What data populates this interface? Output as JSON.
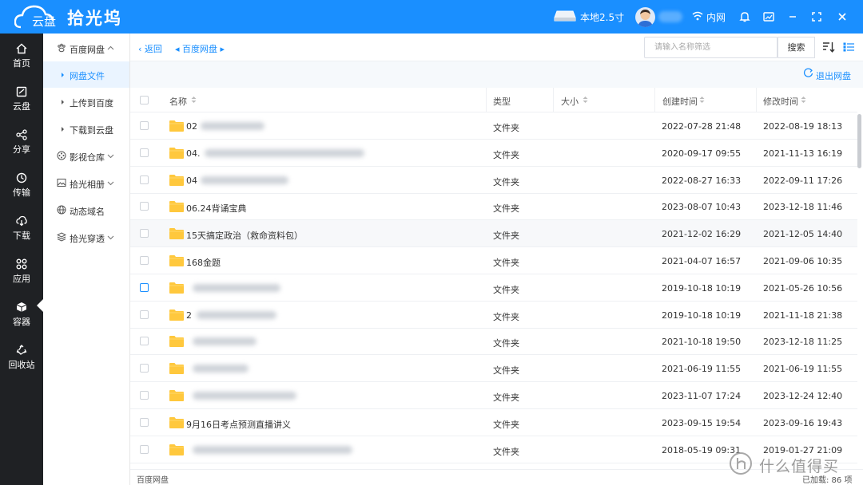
{
  "app": {
    "logo_sub": "云盘",
    "logo_name": "拾光坞",
    "disk_label": "本地2.5寸",
    "network_label": "内网"
  },
  "leftnav": [
    {
      "label": "首页",
      "icon": "home-icon"
    },
    {
      "label": "云盘",
      "icon": "cloud-disk-icon"
    },
    {
      "label": "分享",
      "icon": "share-icon"
    },
    {
      "label": "传输",
      "icon": "transfer-icon"
    },
    {
      "label": "下载",
      "icon": "download-icon"
    },
    {
      "label": "应用",
      "icon": "apps-icon"
    },
    {
      "label": "容器",
      "icon": "container-icon"
    },
    {
      "label": "回收站",
      "icon": "recycle-bin-icon"
    }
  ],
  "subnav": {
    "baidu": "百度网盘",
    "netdisk_files": "网盘文件",
    "upload_baidu": "上传到百度",
    "download_cloud": "下载到云盘",
    "video": "影视仓库",
    "album": "拾光相册",
    "ddns": "动态域名",
    "tunnel": "拾光穿透"
  },
  "toolbar": {
    "back": "返回",
    "crumb": "百度网盘",
    "search_placeholder": "请输入名称筛选",
    "search_btn": "搜索",
    "exit": "退出网盘"
  },
  "table": {
    "headers": {
      "name": "名称",
      "type": "类型",
      "size": "大小",
      "created": "创建时间",
      "modified": "修改时间"
    },
    "rows": [
      {
        "name": "02",
        "type": "文件夹",
        "created": "2022-07-28 21:48",
        "modified": "2022-08-19 18:13"
      },
      {
        "name": "04.",
        "type": "文件夹",
        "created": "2020-09-17 09:55",
        "modified": "2021-11-13 16:19"
      },
      {
        "name": "04",
        "type": "文件夹",
        "created": "2022-08-27 16:33",
        "modified": "2022-09-11 17:26"
      },
      {
        "name": "06.24背诵宝典",
        "type": "文件夹",
        "created": "2023-08-07 10:43",
        "modified": "2023-12-18 11:46"
      },
      {
        "name": "15天搞定政治（救命资料包）",
        "type": "文件夹",
        "created": "2021-12-02 16:29",
        "modified": "2021-12-05 14:40"
      },
      {
        "name": "168金题",
        "type": "文件夹",
        "created": "2021-04-07 16:57",
        "modified": "2021-09-06 10:35"
      },
      {
        "name": "",
        "type": "文件夹",
        "created": "2019-10-18 10:19",
        "modified": "2021-05-26 10:56"
      },
      {
        "name": "2",
        "type": "文件夹",
        "created": "2019-10-18 10:19",
        "modified": "2021-11-18 21:38"
      },
      {
        "name": "",
        "type": "文件夹",
        "created": "2021-10-18 19:50",
        "modified": "2023-12-18 11:25"
      },
      {
        "name": "",
        "type": "文件夹",
        "created": "2021-06-19 11:55",
        "modified": "2021-06-19 11:55"
      },
      {
        "name": "",
        "type": "文件夹",
        "created": "2023-11-07 17:24",
        "modified": "2023-12-24 12:40"
      },
      {
        "name": "9月16日考点预测直播讲义",
        "type": "文件夹",
        "created": "2023-09-15 19:54",
        "modified": "2023-09-16 19:43"
      },
      {
        "name": "",
        "type": "文件夹",
        "created": "2018-05-19 09:31",
        "modified": "2019-01-27 21:09"
      }
    ]
  },
  "footer": {
    "path": "百度网盘",
    "loaded": "已加载: 86 项"
  },
  "watermark": "什么值得买",
  "colors": {
    "brand": "#1a8fff",
    "nav_bg": "#1f2124",
    "folder": "#ffc83d"
  }
}
